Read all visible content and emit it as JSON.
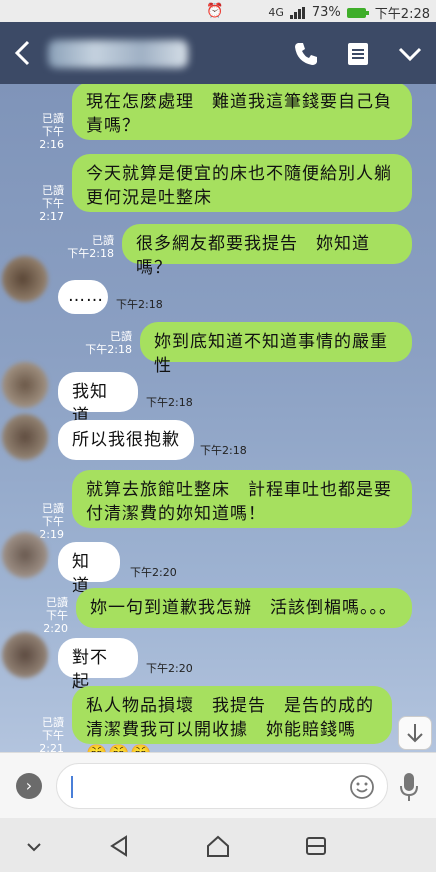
{
  "status_bar": {
    "battery": "73%",
    "time": "下午2:28",
    "network": "4G"
  },
  "header": {
    "back_icon": "chevron-left-icon",
    "call_icon": "phone-icon",
    "notes_icon": "notes-icon",
    "menu_icon": "chevron-down-icon"
  },
  "messages": [
    {
      "dir": "out",
      "read": "已讀",
      "time": "下午2:16",
      "text": "現在怎麼處理　難道我這筆錢要自己負責嗎？"
    },
    {
      "dir": "out",
      "read": "已讀",
      "time": "下午2:17",
      "text": "今天就算是便宜的床也不隨便給別人躺 更何況是吐整床"
    },
    {
      "dir": "out",
      "read": "已讀",
      "time": "下午2:18",
      "text": "很多網友都要我提告　妳知道嗎？"
    },
    {
      "dir": "in",
      "time": "下午2:18",
      "text": "……"
    },
    {
      "dir": "out",
      "read": "已讀",
      "time": "下午2:18",
      "text": "妳到底知道不知道事情的嚴重性"
    },
    {
      "dir": "in",
      "time": "下午2:18",
      "text": "我知道"
    },
    {
      "dir": "in",
      "time": "下午2:18",
      "text": "所以我很抱歉"
    },
    {
      "dir": "out",
      "read": "已讀",
      "time": "下午2:19",
      "text": "就算去旅館吐整床　計程車吐也都是要付清潔費的妳知道嗎！"
    },
    {
      "dir": "in",
      "time": "下午2:20",
      "text": "知道"
    },
    {
      "dir": "out",
      "read": "已讀",
      "time": "下午2:20",
      "text": "妳一句到道歉我怎辦　活該倒楣嗎。。。"
    },
    {
      "dir": "in",
      "time": "下午2:20",
      "text": "對不起"
    },
    {
      "dir": "out",
      "read": "已讀",
      "time": "下午2:21",
      "text": "私人物品損壞　我提告　是告的成的　清潔費我可以開收據　妳能賠錢嗎😤😤😤"
    }
  ],
  "input": {
    "placeholder": ""
  }
}
